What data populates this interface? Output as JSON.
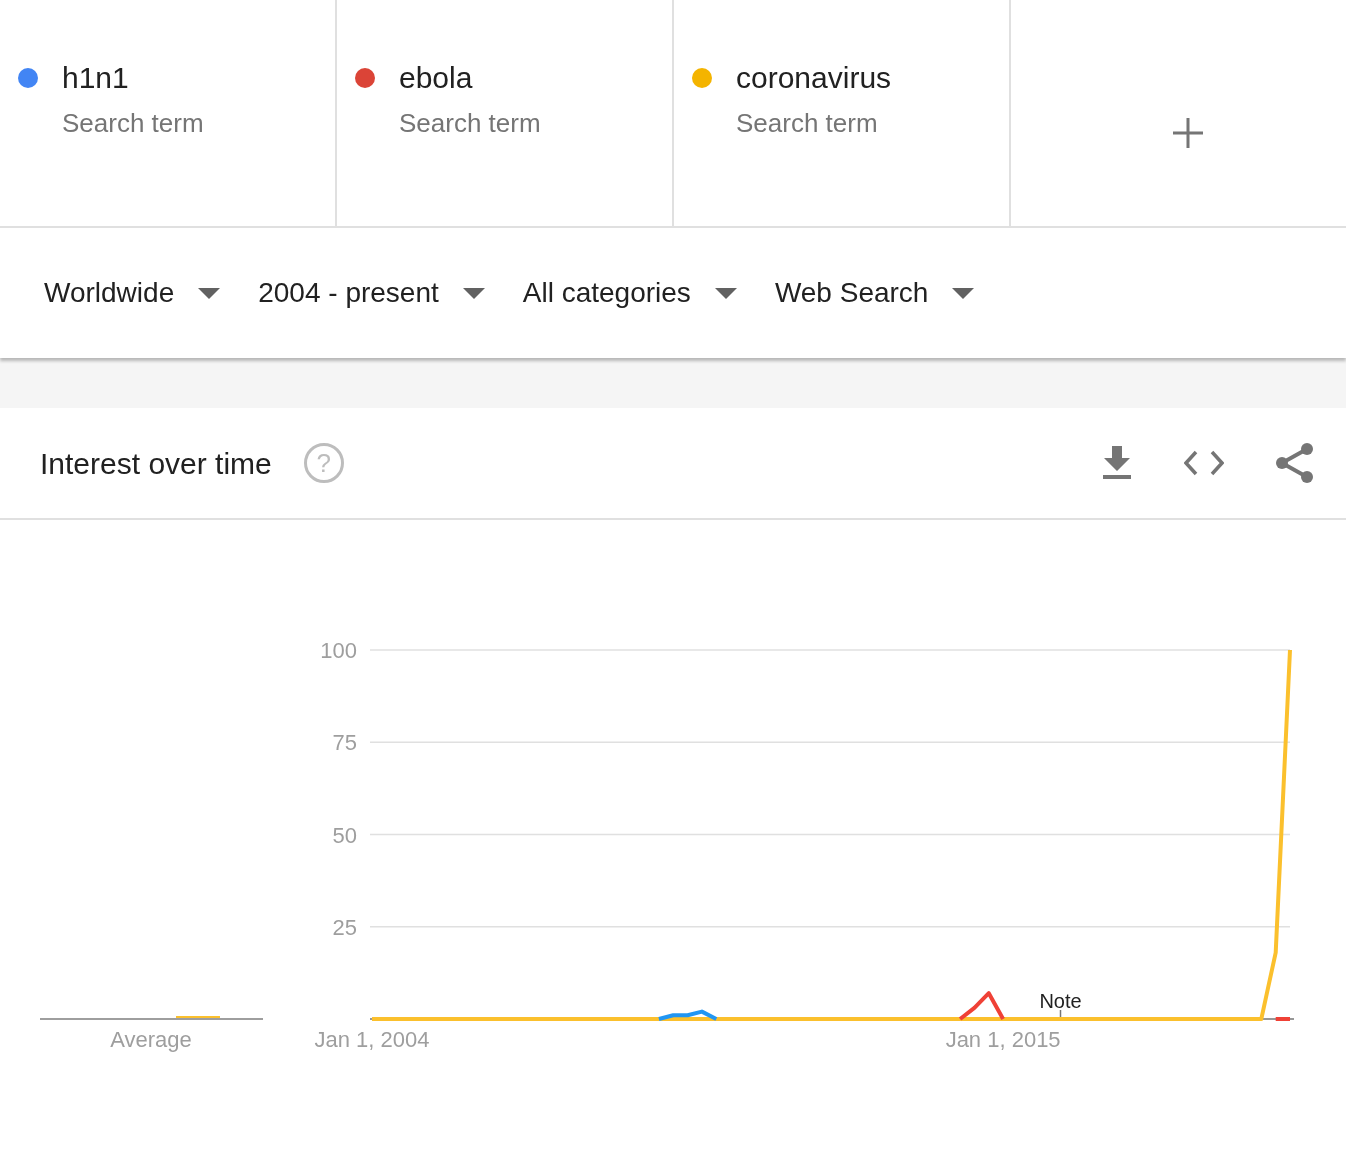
{
  "terms": [
    {
      "name": "h1n1",
      "subtitle": "Search term",
      "color": "#4285f4"
    },
    {
      "name": "ebola",
      "subtitle": "Search term",
      "color": "#db4437"
    },
    {
      "name": "coronavirus",
      "subtitle": "Search term",
      "color": "#f4b400"
    }
  ],
  "filters": [
    "Worldwide",
    "2004 - present",
    "All categories",
    "Web Search"
  ],
  "interest_over_time": {
    "title": "Interest over time",
    "help": "?",
    "average_label": "Average",
    "chart_data": {
      "type": "line",
      "categories": [
        "Jan 1, 2004",
        null,
        null,
        null,
        null,
        null,
        null,
        null,
        null,
        null,
        null,
        null,
        null,
        null,
        null,
        null,
        null,
        null,
        null,
        null,
        null,
        null,
        null,
        null,
        null,
        null,
        null,
        null,
        null,
        null,
        null,
        null,
        null,
        null,
        null,
        null,
        null,
        null,
        null,
        null,
        null,
        null,
        null,
        null,
        "Jan 1, 2015",
        null,
        null,
        null,
        null,
        null,
        null,
        null,
        null,
        null,
        null,
        null,
        null,
        null,
        null,
        null,
        null,
        null,
        null,
        null,
        null
      ],
      "series": [
        {
          "color": "#2196f3",
          "values": [
            null,
            null,
            null,
            null,
            null,
            null,
            null,
            null,
            null,
            null,
            null,
            null,
            null,
            null,
            null,
            null,
            null,
            null,
            null,
            null,
            0,
            1,
            1,
            2,
            0,
            null,
            null,
            null,
            null,
            null,
            null,
            null,
            null,
            null,
            null,
            null,
            null,
            null,
            null,
            null,
            null,
            null,
            null,
            null,
            null,
            null,
            null,
            null,
            null,
            null,
            null,
            null,
            null,
            null,
            null,
            null,
            null,
            null,
            null,
            null,
            null,
            null,
            null,
            null,
            null
          ]
        },
        {
          "color": "#ef4136",
          "values": [
            null,
            null,
            null,
            null,
            null,
            null,
            null,
            null,
            null,
            null,
            null,
            null,
            null,
            null,
            null,
            null,
            null,
            null,
            null,
            null,
            null,
            null,
            null,
            null,
            null,
            null,
            null,
            null,
            null,
            null,
            null,
            null,
            null,
            null,
            null,
            null,
            null,
            null,
            null,
            null,
            null,
            0,
            3,
            7,
            0,
            null,
            null,
            null,
            null,
            null,
            null,
            null,
            null,
            null,
            null,
            null,
            null,
            null,
            null,
            null,
            null,
            null,
            null,
            0,
            0
          ]
        },
        {
          "color": "#fbc02d",
          "values": [
            0,
            0,
            0,
            0,
            0,
            0,
            0,
            0,
            0,
            0,
            0,
            0,
            0,
            0,
            0,
            0,
            0,
            0,
            0,
            0,
            0,
            0,
            0,
            0,
            0,
            0,
            0,
            0,
            0,
            0,
            0,
            0,
            0,
            0,
            0,
            0,
            0,
            0,
            0,
            0,
            0,
            0,
            0,
            0,
            0,
            0,
            0,
            0,
            0,
            0,
            0,
            0,
            0,
            0,
            0,
            0,
            0,
            0,
            0,
            0,
            0,
            0,
            0,
            18,
            100
          ]
        }
      ],
      "ylim": [
        0,
        100
      ],
      "grid": true,
      "yticks": [
        25,
        50,
        75,
        100
      ],
      "annotations": [
        "Note"
      ]
    }
  }
}
